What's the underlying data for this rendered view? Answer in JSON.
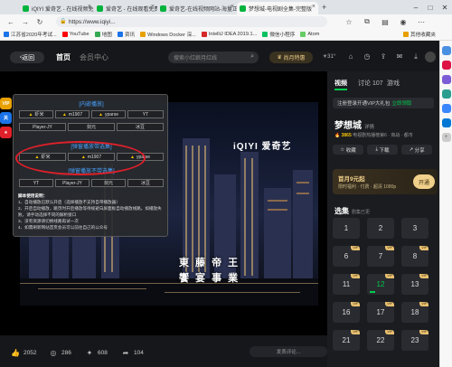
{
  "browser": {
    "tabs": [
      {
        "title": "iQIYI 爱奇艺 - 在线视频免费正版"
      },
      {
        "title": "爱奇艺 - 在线观看免费正版"
      },
      {
        "title": "爱奇艺-在线视频网站-海量正版"
      },
      {
        "title": "梦想城-电视剧全集-完整版"
      }
    ],
    "url": "https://www.iqiyi...",
    "bookmarks": [
      "江苏省2020年考试...",
      "YouTube",
      "地图",
      "资讯",
      "Windows Docker 深...",
      "IntelliJ IDEA 2019.1...",
      "微信小程序",
      "Atom"
    ],
    "bookmarks_right": "其他收藏夹"
  },
  "header": {
    "back_label": "返回",
    "nav_home": "首页",
    "nav_member": "会员中心",
    "search_placeholder": "搜索小红娘月红线",
    "vip_button": "尚月特惠",
    "temp": "31°"
  },
  "panel": {
    "section1_title": "[内嵌播放]",
    "row1": [
      "虾米",
      "m1907",
      "yparse",
      "YT"
    ],
    "row2": [
      "Player-JY",
      "剑元",
      "冰豆"
    ],
    "section2_title": "[弹窗播放带选集]",
    "row3": [
      "虾米",
      "m1907",
      "yparse"
    ],
    "section3_title": "[弹窗播放不带选集]",
    "row4": [
      "YT",
      "Player-JY",
      "剑元",
      "冰豆"
    ],
    "notes_heading": "脚本使用说明：",
    "notes": [
      "1、自动播放已默认开启（选择播放不支持自带播放器）",
      "2、开启自动播放，跳页时开启播放等待规避白屏面板自动播放线路。如播放失败，请手动选择不同的解析接口",
      "3、没有资源请切换线路再试一次",
      "4、如需刷新网站首页会员可以前往自己的公众号"
    ]
  },
  "vip_side_badges": [
    "VIP",
    "关",
    "★"
  ],
  "player": {
    "watermark": "iQIYI 爱奇艺",
    "overlay_text_line1": "東 藤 帝 王",
    "overlay_text_line2": "饗 宴 事 業"
  },
  "bottom": {
    "likes": "2052",
    "comments": "286",
    "shares": "608",
    "forwards": "104",
    "right_text": "发表评论..."
  },
  "right": {
    "tabs": [
      "视频",
      "讨论 107",
      "游戏"
    ],
    "vip_line": "注册登录开通VIP大礼包",
    "vip_link": "立即领取",
    "show_title": "梦想城",
    "show_sub": "详情",
    "score": "3865",
    "meta": "电视剧热播榜第6 · 商战 · 都市",
    "actions": [
      "收藏",
      "下载",
      "分享"
    ],
    "promo_title": "首月9元起",
    "promo_sub": "限时福利 · 付费 · 超清 1080p",
    "promo_btn": "开通",
    "episodes_title": "选集",
    "episodes_sub": "剧集已更",
    "episodes": [
      {
        "n": "1",
        "vip": false
      },
      {
        "n": "2",
        "vip": false
      },
      {
        "n": "3",
        "vip": false
      },
      {
        "n": "6",
        "vip": true
      },
      {
        "n": "7",
        "vip": true
      },
      {
        "n": "8",
        "vip": true
      },
      {
        "n": "11",
        "vip": true
      },
      {
        "n": "12",
        "vip": true,
        "current": true
      },
      {
        "n": "13",
        "vip": true
      },
      {
        "n": "16",
        "vip": true
      },
      {
        "n": "17",
        "vip": true
      },
      {
        "n": "18",
        "vip": true
      },
      {
        "n": "21",
        "vip": true
      },
      {
        "n": "22",
        "vip": true
      },
      {
        "n": "23",
        "vip": true
      }
    ]
  },
  "colors": {
    "accent_green": "#00cc4c",
    "link_blue": "#4aa3ff",
    "annotation_red": "#e0202a",
    "gold": "#f0d08a"
  }
}
